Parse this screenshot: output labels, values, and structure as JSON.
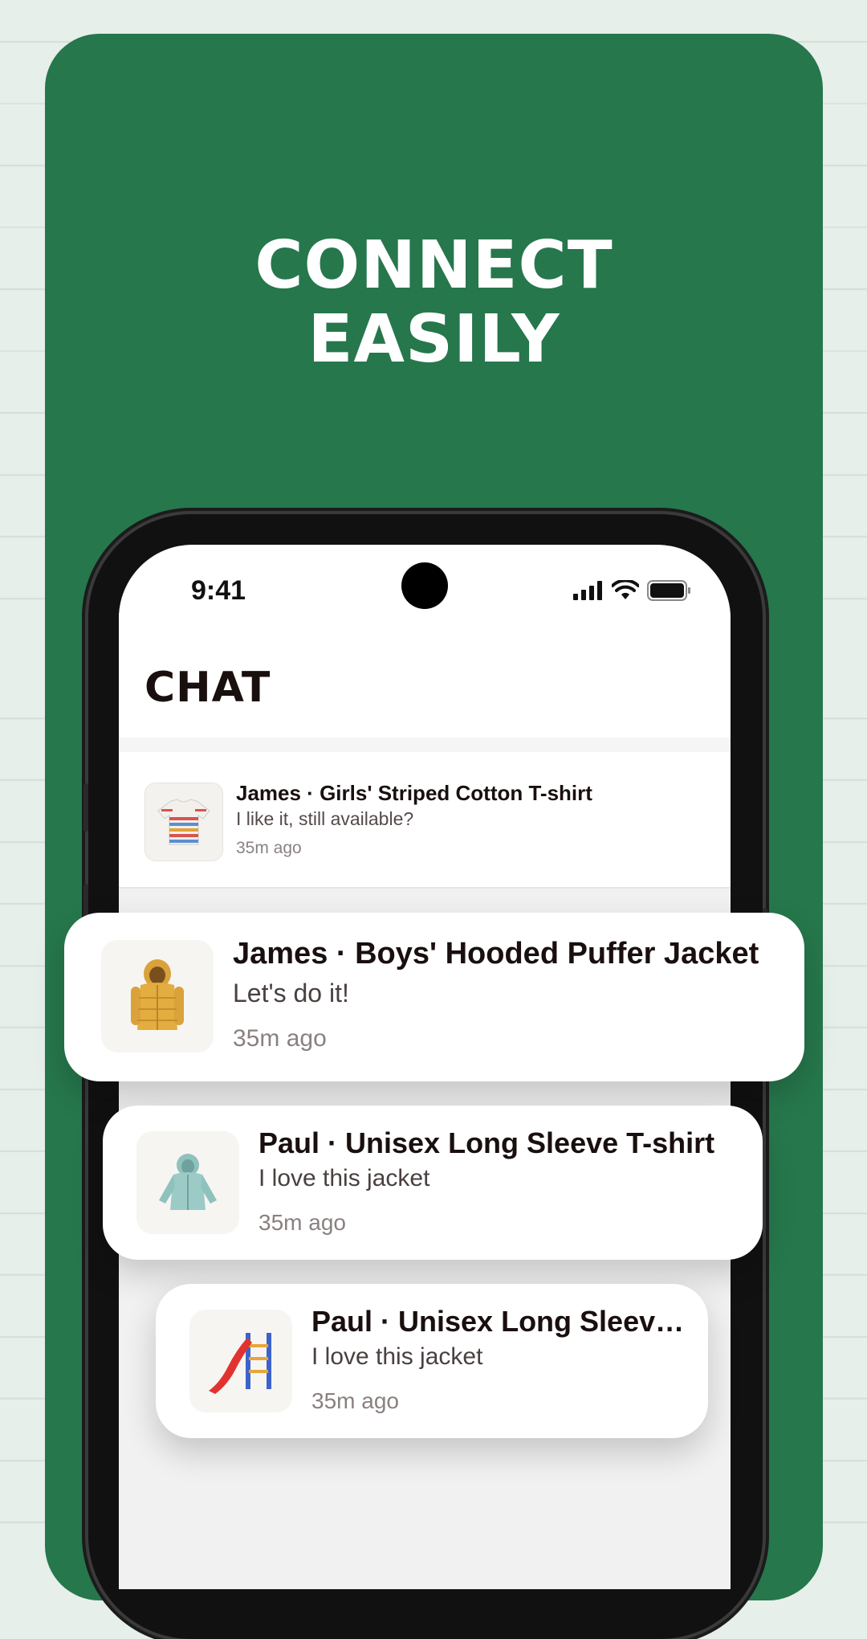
{
  "headline": {
    "line1": "CONNECT",
    "line2": "EASILY"
  },
  "status_bar": {
    "time": "9:41",
    "icons": [
      "signal-icon",
      "wifi-icon",
      "battery-icon"
    ]
  },
  "chat": {
    "title": "CHAT",
    "items": [
      {
        "title": "James · Girls' Striped Cotton T-shirt",
        "message": "I like it, still available?",
        "time": "35m ago",
        "thumb": "striped-tshirt-image"
      },
      {
        "title": "James · Boys' Hooded Puffer Jacket",
        "message": "Let's do it!",
        "time": "35m ago",
        "thumb": "puffer-jacket-image"
      },
      {
        "title": "Paul · Unisex Long Sleeve T-shirt",
        "message": "I love this jacket",
        "time": "35m ago",
        "thumb": "rain-jacket-image"
      },
      {
        "title": "Paul · Unisex Long Sleeve...",
        "message": "I love this jacket",
        "time": "35m ago",
        "thumb": "slide-toy-image"
      }
    ]
  },
  "colors": {
    "brand_green": "#26774c",
    "background": "#e6efea",
    "text_dark": "#1a0f0f"
  }
}
